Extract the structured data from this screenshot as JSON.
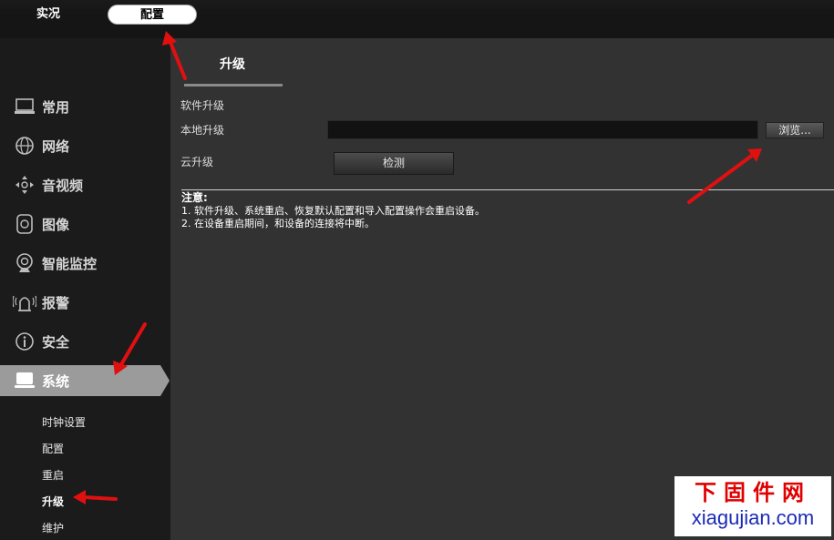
{
  "top_tabs": {
    "live": "实况",
    "config": "配置"
  },
  "sidebar": {
    "items": [
      {
        "label": "常用",
        "icon": "monitor-icon"
      },
      {
        "label": "网络",
        "icon": "globe-icon"
      },
      {
        "label": "音视频",
        "icon": "dpad-icon"
      },
      {
        "label": "图像",
        "icon": "camera-icon"
      },
      {
        "label": "智能监控",
        "icon": "webcam-icon"
      },
      {
        "label": "报警",
        "icon": "alarm-icon"
      },
      {
        "label": "安全",
        "icon": "info-icon"
      },
      {
        "label": "系统",
        "icon": "system-icon"
      }
    ],
    "sub_items": [
      "时钟设置",
      "配置",
      "重启",
      "升级",
      "维护"
    ],
    "active_item": "系统",
    "active_sub_item": "升级"
  },
  "main": {
    "page_tab": "升级",
    "section_title": "软件升级",
    "local_upgrade_label": "本地升级",
    "file_path": "",
    "browse_label": "浏览...",
    "cloud_upgrade_label": "云升级",
    "check_label": "检测",
    "note_title": "注意:",
    "note_lines": [
      "1. 软件升级、系统重启、恢复默认配置和导入配置操作会重启设备。",
      "2. 在设备重启期间，和设备的连接将中断。"
    ]
  },
  "watermark": {
    "line1": "下固件网",
    "line2": "xiagujian.com"
  },
  "colors": {
    "annotation": "#e01010",
    "active_nav": "#9b9b9b",
    "watermark_red": "#e00000",
    "watermark_blue": "#1a2ab8"
  }
}
